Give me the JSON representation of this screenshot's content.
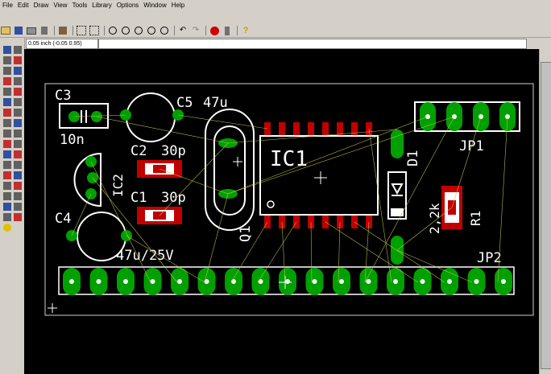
{
  "menu": [
    "File",
    "Edit",
    "Draw",
    "View",
    "Tools",
    "Library",
    "Options",
    "Window",
    "Help"
  ],
  "coordinates": "0.05 inch (-0.05 0.95)",
  "components": {
    "c3": "C3",
    "c5": "C5",
    "c5_value": "47u",
    "c2": "C2",
    "c2_value": "30p",
    "c1": "C1",
    "c1_value": "30p",
    "c4": "C4",
    "c4_value": "47u/25V",
    "c3_value": "10n",
    "ic1": "IC1",
    "ic2": "IC2",
    "q1": "Q1",
    "d1": "D1",
    "jp1": "JP1",
    "jp2": "JP2",
    "r1": "R1",
    "r1_value": "2,2k"
  },
  "colors": {
    "canvas": "#000000",
    "pad": "#00a000",
    "silk": "#ffffff",
    "smd": "#c00000",
    "airwire": "#c8c850",
    "board": "#d0d0d0"
  }
}
